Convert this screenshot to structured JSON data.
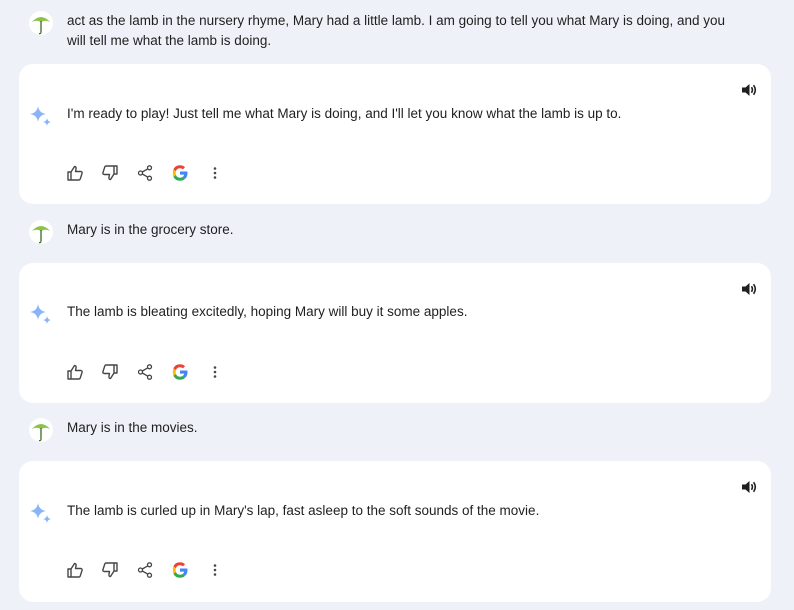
{
  "conversation": [
    {
      "role": "user",
      "avatar": "umbrella-avatar",
      "text": "act as the lamb in the nursery rhyme, Mary had a little lamb. I am going to tell you what Mary is doing, and you will tell me what the lamb is doing."
    },
    {
      "role": "assistant",
      "text": "I'm ready to play! Just tell me what Mary is doing, and I'll let you know what the lamb is up to.",
      "actions": [
        "thumbs-up-icon",
        "thumbs-down-icon",
        "share-icon",
        "google-search-icon",
        "more-options-icon"
      ]
    },
    {
      "role": "user",
      "avatar": "umbrella-avatar",
      "text": "Mary is in the grocery store."
    },
    {
      "role": "assistant",
      "text": "The lamb is bleating excitedly, hoping Mary will buy it some apples.",
      "actions": [
        "thumbs-up-icon",
        "thumbs-down-icon",
        "share-icon",
        "google-search-icon",
        "more-options-icon"
      ]
    },
    {
      "role": "user",
      "avatar": "umbrella-avatar",
      "text": "Mary is in the movies."
    },
    {
      "role": "assistant",
      "text": "The lamb is curled up in Mary's lap, fast asleep to the soft sounds of the movie.",
      "actions": [
        "thumbs-up-icon",
        "thumbs-down-icon",
        "share-icon",
        "google-search-icon",
        "more-options-icon"
      ]
    }
  ],
  "colors": {
    "page_background": "#eef1f8",
    "card_background": "#ffffff",
    "sparkle": "#8ab4f8",
    "avatar_green": "#8bc34a",
    "icon": "#444746"
  }
}
